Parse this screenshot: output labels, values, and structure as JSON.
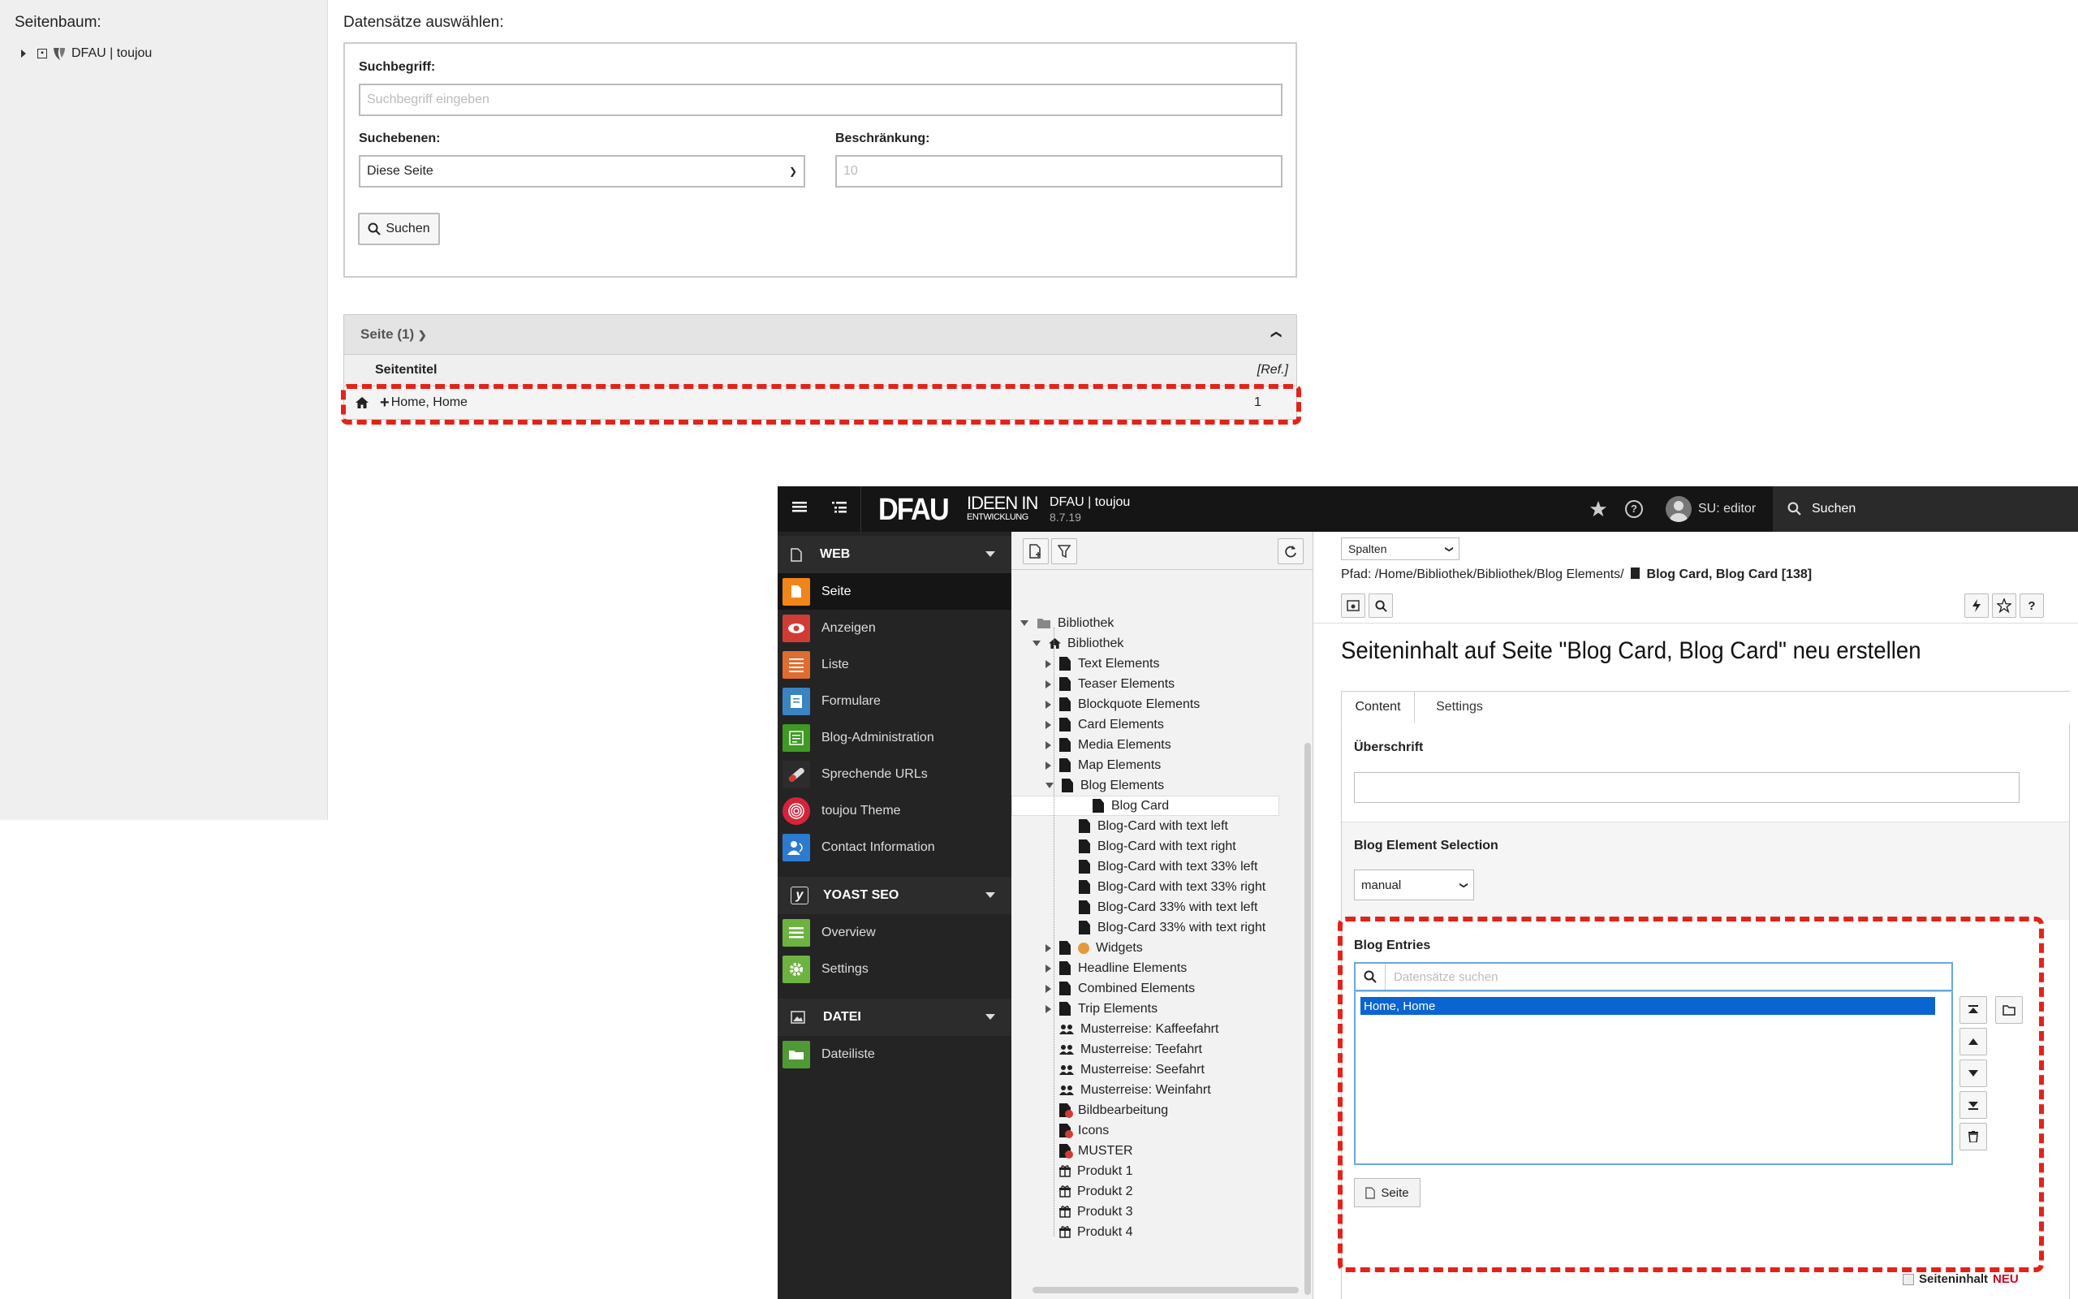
{
  "record_browser": {
    "tree_title": "Seitenbaum:",
    "tree_root": "DFAU | toujou",
    "select_title": "Datensätze auswählen:",
    "search_term_label": "Suchbegriff:",
    "search_term_placeholder": "Suchbegriff eingeben",
    "search_levels_label": "Suchebenen:",
    "search_levels_value": "Diese Seite",
    "limit_label": "Beschränkung:",
    "limit_placeholder": "10",
    "search_button": "Suchen",
    "results_header": "Seite (1)",
    "col_title": "Seitentitel",
    "col_ref": "[Ref.]",
    "rows": [
      {
        "title": "Home, Home",
        "ref": "1"
      }
    ]
  },
  "topbar": {
    "brand": "DFAU",
    "brand_tag_1": "IDEEN IN",
    "brand_tag_2": "ENTWICKLUNG",
    "site_name": "DFAU | toujou",
    "version": "8.7.19",
    "user": "SU: editor",
    "search_label": "Suchen"
  },
  "modules": {
    "web_group": "WEB",
    "web_items": [
      "Seite",
      "Anzeigen",
      "Liste",
      "Formulare",
      "Blog-Administration",
      "Sprechende URLs",
      "toujou Theme",
      "Contact Information"
    ],
    "yoast_group": "YOAST SEO",
    "yoast_items": [
      "Overview",
      "Settings"
    ],
    "file_group": "DATEI",
    "file_items": [
      "Dateiliste"
    ],
    "colors": {
      "seite": "#f18519",
      "anzeigen": "#d13b36",
      "liste": "#e06c2f",
      "formulare": "#3a84c3",
      "blog": "#3f9a23",
      "urls": "#555555",
      "theme": "#d6233a",
      "contact": "#2b7bd0",
      "yoast": "#6db33f",
      "file": "#4f9a35"
    }
  },
  "pagetree": {
    "nodes": [
      "Bibliothek",
      "Bibliothek",
      "Text Elements",
      "Teaser Elements",
      "Blockquote Elements",
      "Card Elements",
      "Media Elements",
      "Map Elements",
      "Blog Elements",
      "Blog Card",
      "Blog-Card with text left",
      "Blog-Card with text right",
      "Blog-Card with text 33% left",
      "Blog-Card with text 33% right",
      "Blog-Card 33% with text left",
      "Blog-Card 33% with text right",
      "Widgets",
      "Headline Elements",
      "Combined Elements",
      "Trip Elements",
      "Musterreise: Kaffeefahrt",
      "Musterreise: Teefahrt",
      "Musterreise: Seefahrt",
      "Musterreise: Weinfahrt",
      "Bildbearbeitung",
      "Icons",
      "MUSTER",
      "Produkt 1",
      "Produkt 2",
      "Produkt 3",
      "Produkt 4"
    ]
  },
  "editor": {
    "view_select": "Spalten",
    "path_label": "Pfad: /Home/Bibliothek/Bibliothek/Blog Elements/",
    "path_record": "Blog Card, Blog Card [138]",
    "heading": "Seiteninhalt auf Seite \"Blog Card, Blog Card\" neu erstellen",
    "tab_content": "Content",
    "tab_settings": "Settings",
    "headline_label": "Überschrift",
    "selection_label": "Blog Element Selection",
    "selection_value": "manual",
    "entries_label": "Blog Entries",
    "entries_search_placeholder": "Datensätze suchen",
    "entries_items": [
      "Home, Home"
    ],
    "page_button": "Seite",
    "footer_label": "Seiteninhalt",
    "footer_new": "NEU"
  }
}
